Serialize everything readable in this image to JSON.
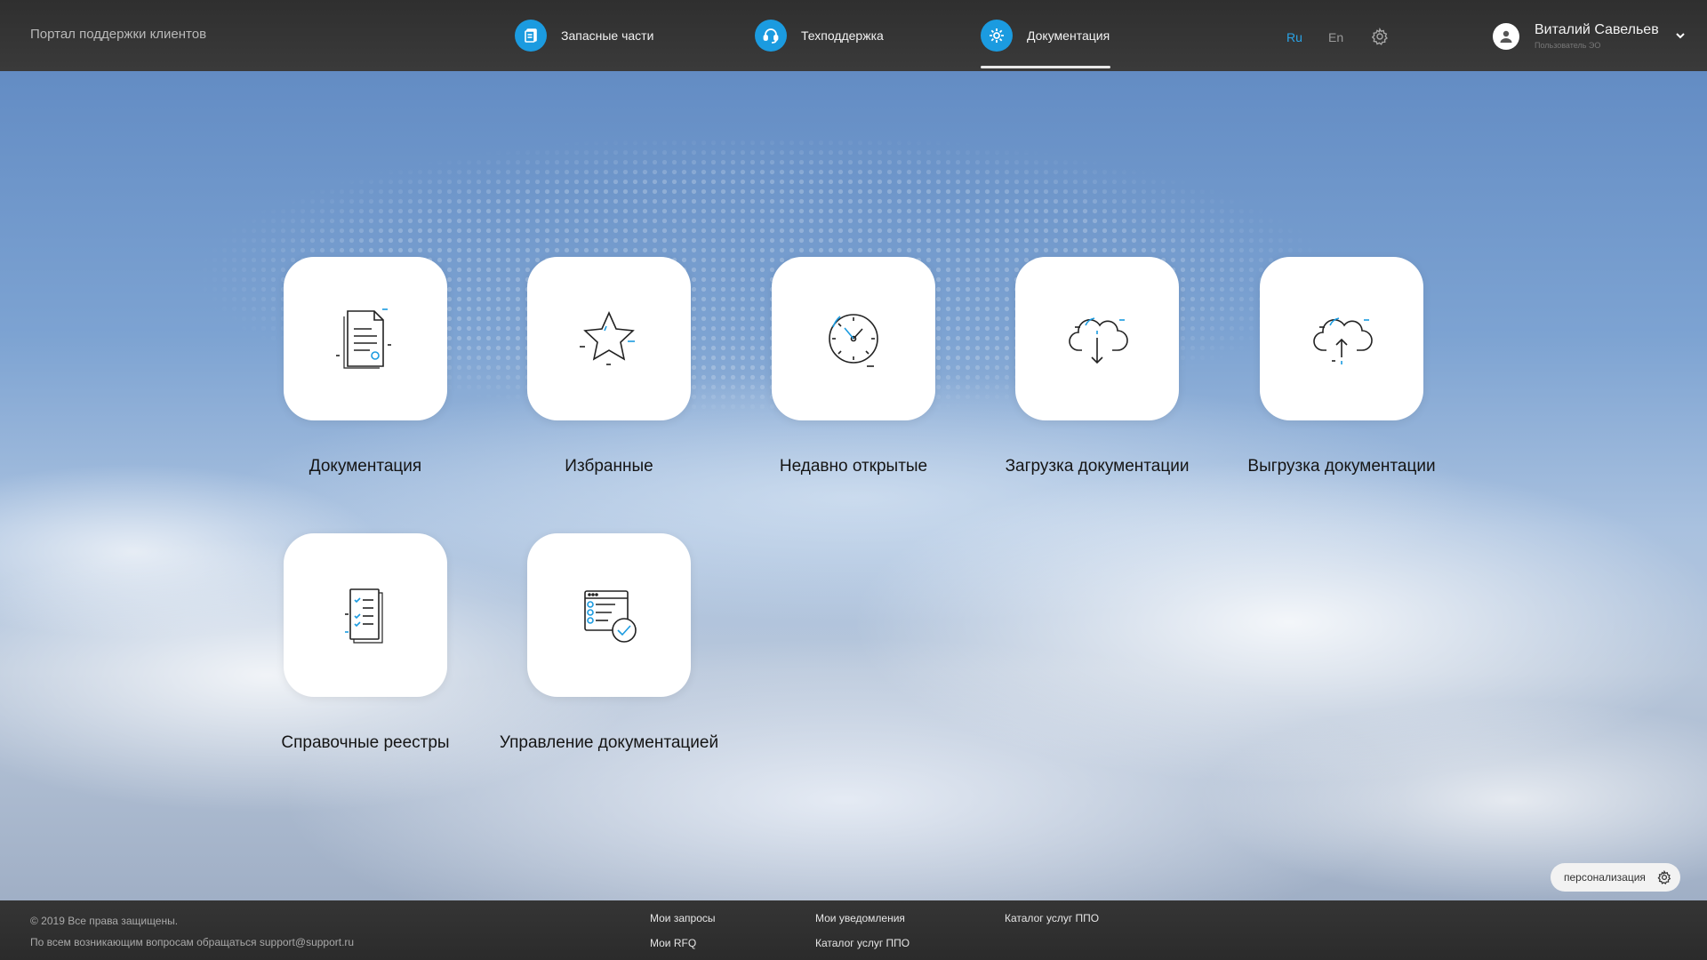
{
  "header": {
    "portal_title": "Портал поддержки клиентов",
    "nav": [
      {
        "label": "Запасные части",
        "icon": "document-icon"
      },
      {
        "label": "Техподдержка",
        "icon": "headset-icon"
      },
      {
        "label": "Документация",
        "icon": "gear-icon",
        "active": true
      }
    ],
    "lang_ru": "Ru",
    "lang_en": "En",
    "user_name": "Виталий Савельев",
    "user_role": "Пользователь ЭО"
  },
  "tiles": [
    {
      "label": "Документация",
      "icon": "document-icon"
    },
    {
      "label": "Избранные",
      "icon": "star-icon"
    },
    {
      "label": "Недавно открытые",
      "icon": "clock-icon"
    },
    {
      "label": "Загрузка документации",
      "icon": "cloud-download-icon"
    },
    {
      "label": "Выгрузка документации",
      "icon": "cloud-upload-icon"
    },
    {
      "label": "Справочные реестры",
      "icon": "checklist-icon"
    },
    {
      "label": "Управление документацией",
      "icon": "document-management-icon"
    }
  ],
  "personalization": {
    "label": "персонализация"
  },
  "footer": {
    "copyright": "© 2019 Все права защищены.",
    "contact": "По всем возникающим вопросам обращаться support@support.ru",
    "links": [
      "Мои запросы",
      "Мои RFQ",
      "Мои уведомления",
      "Каталог услуг ППО",
      "Каталог услуг ППО"
    ]
  },
  "colors": {
    "accent": "#1b9be0",
    "header_bg": "#333333",
    "tile_bg": "#ffffff"
  }
}
